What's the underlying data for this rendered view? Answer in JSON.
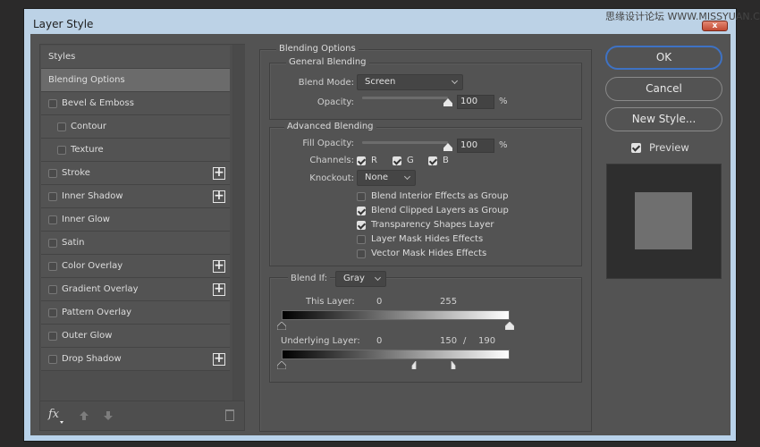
{
  "window": {
    "title": "Layer Style",
    "close_label": "x",
    "watermark": "思缘设计论坛  WWW.MISSYUAN.COM"
  },
  "styles": {
    "items": [
      {
        "label": "Styles",
        "checkbox": false,
        "has_checkbox": false,
        "plus": false,
        "indent": false,
        "selected": false
      },
      {
        "label": "Blending Options",
        "checkbox": false,
        "has_checkbox": false,
        "plus": false,
        "indent": false,
        "selected": true
      },
      {
        "label": "Bevel & Emboss",
        "checkbox": false,
        "has_checkbox": true,
        "plus": false,
        "indent": false,
        "selected": false
      },
      {
        "label": "Contour",
        "checkbox": false,
        "has_checkbox": true,
        "plus": false,
        "indent": true,
        "selected": false
      },
      {
        "label": "Texture",
        "checkbox": false,
        "has_checkbox": true,
        "plus": false,
        "indent": true,
        "selected": false
      },
      {
        "label": "Stroke",
        "checkbox": false,
        "has_checkbox": true,
        "plus": true,
        "indent": false,
        "selected": false
      },
      {
        "label": "Inner Shadow",
        "checkbox": false,
        "has_checkbox": true,
        "plus": true,
        "indent": false,
        "selected": false
      },
      {
        "label": "Inner Glow",
        "checkbox": false,
        "has_checkbox": true,
        "plus": false,
        "indent": false,
        "selected": false
      },
      {
        "label": "Satin",
        "checkbox": false,
        "has_checkbox": true,
        "plus": false,
        "indent": false,
        "selected": false
      },
      {
        "label": "Color Overlay",
        "checkbox": false,
        "has_checkbox": true,
        "plus": true,
        "indent": false,
        "selected": false
      },
      {
        "label": "Gradient Overlay",
        "checkbox": false,
        "has_checkbox": true,
        "plus": true,
        "indent": false,
        "selected": false
      },
      {
        "label": "Pattern Overlay",
        "checkbox": false,
        "has_checkbox": true,
        "plus": false,
        "indent": false,
        "selected": false
      },
      {
        "label": "Outer Glow",
        "checkbox": false,
        "has_checkbox": true,
        "plus": false,
        "indent": false,
        "selected": false
      },
      {
        "label": "Drop Shadow",
        "checkbox": false,
        "has_checkbox": true,
        "plus": true,
        "indent": false,
        "selected": false
      }
    ],
    "footer": {
      "fx_label": "fx",
      "icons": [
        "fx-menu-icon",
        "move-up-icon",
        "move-down-icon",
        "trash-icon"
      ]
    }
  },
  "blending": {
    "title": "Blending Options",
    "general": {
      "title": "General Blending",
      "blend_mode_label": "Blend Mode:",
      "blend_mode_value": "Screen",
      "opacity_label": "Opacity:",
      "opacity_value": "100",
      "opacity_percent": 100,
      "pct": "%"
    },
    "advanced": {
      "title": "Advanced Blending",
      "fill_opacity_label": "Fill Opacity:",
      "fill_opacity_value": "100",
      "fill_opacity_percent": 100,
      "pct": "%",
      "channels_label": "Channels:",
      "channels": [
        {
          "label": "R",
          "checked": true
        },
        {
          "label": "G",
          "checked": true
        },
        {
          "label": "B",
          "checked": true
        }
      ],
      "knockout_label": "Knockout:",
      "knockout_value": "None",
      "options": [
        {
          "label": "Blend Interior Effects as Group",
          "checked": false
        },
        {
          "label": "Blend Clipped Layers as Group",
          "checked": true
        },
        {
          "label": "Transparency Shapes Layer",
          "checked": true
        },
        {
          "label": "Layer Mask Hides Effects",
          "checked": false
        },
        {
          "label": "Vector Mask Hides Effects",
          "checked": false
        }
      ]
    },
    "blend_if": {
      "label": "Blend If:",
      "value": "Gray",
      "this_layer": {
        "label": "This Layer:",
        "low": "0",
        "high": "255",
        "low_value": 0,
        "high_value": 255
      },
      "underlying_layer": {
        "label": "Underlying Layer:",
        "low": "0",
        "high_a": "150",
        "sep": "/",
        "high_b": "190",
        "low_value": 0,
        "high_split": [
          150,
          190
        ]
      }
    }
  },
  "actions": {
    "ok": "OK",
    "cancel": "Cancel",
    "new_style": "New Style...",
    "preview_label": "Preview",
    "preview_checked": true
  }
}
